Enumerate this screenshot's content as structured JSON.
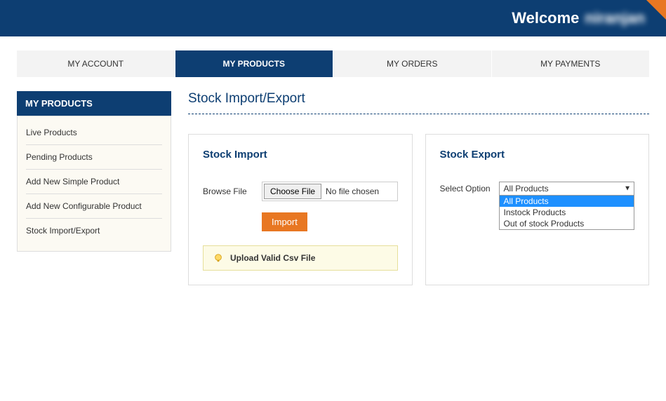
{
  "header": {
    "welcome": "Welcome",
    "username": "niranjan"
  },
  "tabs": [
    {
      "label": "MY ACCOUNT",
      "active": false
    },
    {
      "label": "MY PRODUCTS",
      "active": true
    },
    {
      "label": "MY ORDERS",
      "active": false
    },
    {
      "label": "MY PAYMENTS",
      "active": false
    }
  ],
  "sidebar": {
    "header": "MY PRODUCTS",
    "items": [
      {
        "label": "Live Products"
      },
      {
        "label": "Pending Products"
      },
      {
        "label": "Add New Simple Product"
      },
      {
        "label": "Add New Configurable Product"
      },
      {
        "label": "Stock Import/Export"
      }
    ]
  },
  "page": {
    "title": "Stock Import/Export"
  },
  "stock_import": {
    "title": "Stock Import",
    "browse_label": "Browse File",
    "choose_file_btn": "Choose File",
    "file_status": "No file chosen",
    "import_btn": "Import",
    "info_text": "Upload Valid Csv File"
  },
  "stock_export": {
    "title": "Stock Export",
    "select_label": "Select Option",
    "selected_value": "All Products",
    "options": [
      {
        "label": "All Products",
        "selected": true
      },
      {
        "label": "Instock Products",
        "selected": false
      },
      {
        "label": "Out of stock Products",
        "selected": false
      }
    ]
  }
}
